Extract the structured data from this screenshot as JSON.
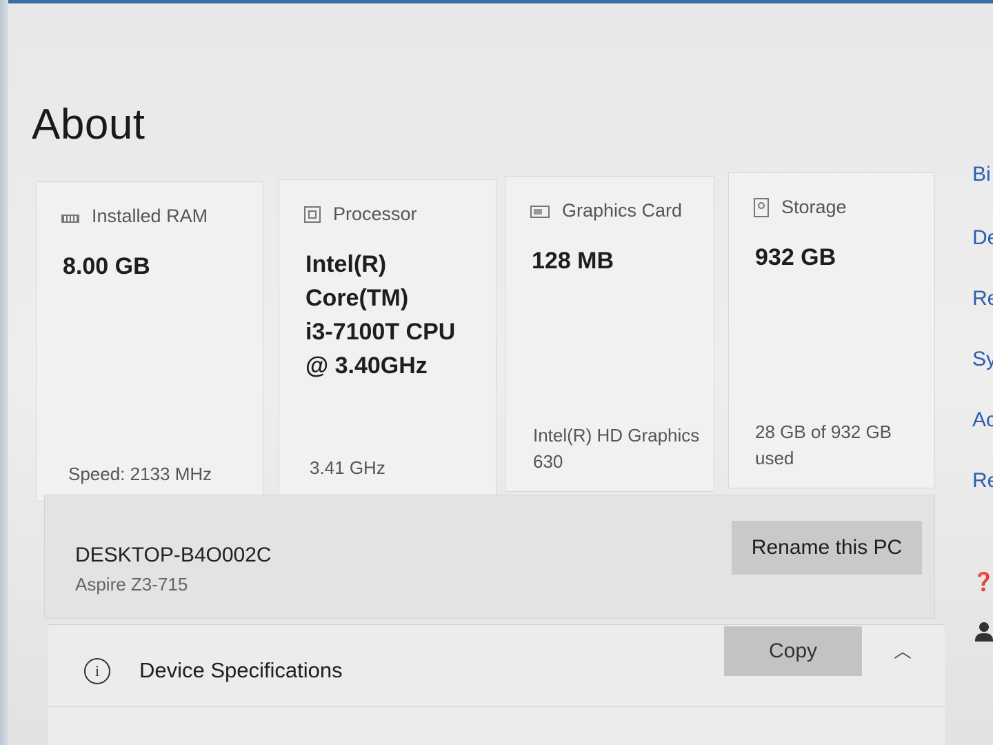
{
  "page": {
    "title": "About"
  },
  "specs": {
    "ram": {
      "icon": "ram-icon",
      "label": "Installed RAM",
      "value": "8.00 GB",
      "detail": "Speed: 2133 MHz"
    },
    "processor": {
      "icon": "processor-icon",
      "label": "Processor",
      "value": "Intel(R)\nCore(TM)\ni3-7100T CPU\n@ 3.40GHz",
      "detail": "3.41 GHz"
    },
    "graphics": {
      "icon": "graphics-card-icon",
      "label": "Graphics Card",
      "value": "128 MB",
      "detail": "Intel(R) HD Graphics\n630"
    },
    "storage": {
      "icon": "storage-icon",
      "label": "Storage",
      "value": "932 GB",
      "detail": "28 GB of 932 GB\nused"
    }
  },
  "pc": {
    "name": "DESKTOP-B4O002C",
    "model": "Aspire Z3-715",
    "rename_label": "Rename this PC"
  },
  "device_specs": {
    "title": "Device Specifications",
    "copy_label": "Copy",
    "info_icon": "info-icon",
    "chevron_icon": "chevron-up-icon"
  },
  "related_links": [
    "Bi",
    "De",
    "Re",
    "Sy",
    "Ac",
    "Re"
  ]
}
